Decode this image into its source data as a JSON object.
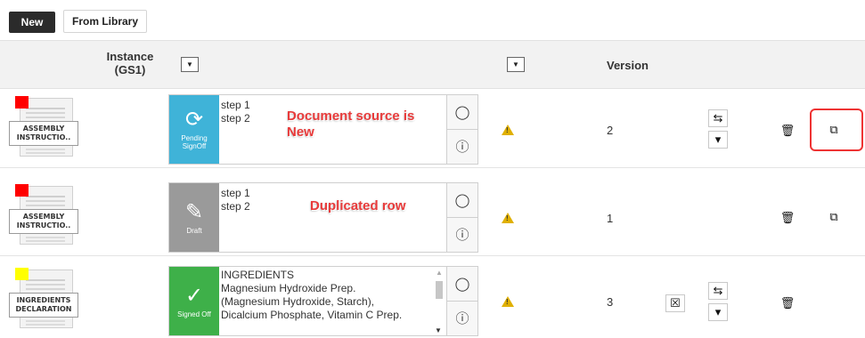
{
  "toolbar": {
    "new_label": "New",
    "library_label": "From Library"
  },
  "header": {
    "instance_label": "Instance (GS1)",
    "version_label": "Version",
    "filter_glyph": "▼"
  },
  "rows": [
    {
      "doc_label_1": "ASSEMBLY",
      "doc_label_2": "INSTRUCTIO..",
      "flag_color": "#ff0000",
      "status_text": "Pending SignOff",
      "status_icon": "refresh-icon",
      "status_color": "#3fb3d8",
      "content": "step 1\nstep 2",
      "annotation": "Document source is New",
      "version": "2"
    },
    {
      "doc_label_1": "ASSEMBLY",
      "doc_label_2": "INSTRUCTIO..",
      "flag_color": "#ff0000",
      "status_text": "Draft",
      "status_icon": "pencil-icon",
      "status_color": "#9a9a9a",
      "content": "step 1\nstep 2",
      "annotation": "Duplicated row",
      "version": "1"
    },
    {
      "doc_label_1": "INGREDIENTS",
      "doc_label_2": "DECLARATION",
      "flag_color": "#ffff00",
      "status_text": "Signed Off",
      "status_icon": "check-icon",
      "status_color": "#3eb049",
      "content": "INGREDIENTS\nMagnesium Hydroxide Prep.\n(Magnesium Hydroxide, Starch),\nDicalcium Phosphate, Vitamin C Prep.",
      "version": "3"
    }
  ],
  "colors": {
    "highlight_border": "#e33333",
    "warning": "#e0b000",
    "annotation": "#e83b3b"
  }
}
